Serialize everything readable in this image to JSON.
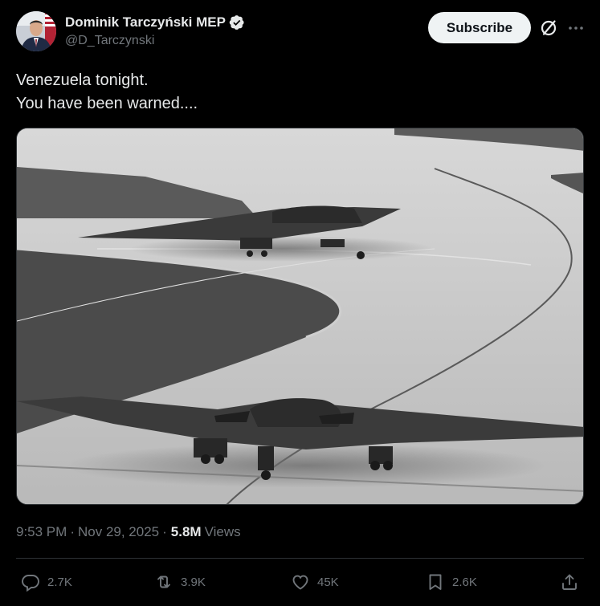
{
  "author": {
    "name": "Dominik Tarczyński MEP",
    "handle": "@D_Tarczynski",
    "verified": true
  },
  "header": {
    "subscribe_label": "Subscribe",
    "icons": [
      "grok-icon",
      "more-icon"
    ]
  },
  "tweet": {
    "lines": [
      "Venezuela tonight.",
      "You have been warned...."
    ],
    "media_description_icon": "image"
  },
  "meta": {
    "time": "9:53 PM",
    "separator": "·",
    "date": "Nov 29, 2025",
    "views_count": "5.8M",
    "views_label": "Views"
  },
  "actions": {
    "replies": "2.7K",
    "reposts": "3.9K",
    "likes": "45K",
    "bookmarks": "2.6K"
  },
  "colors": {
    "background": "#000000",
    "text_primary": "#e7e9ea",
    "text_secondary": "#71767b",
    "verified": "#e7e9ea",
    "subscribe_bg": "#eff3f4"
  }
}
